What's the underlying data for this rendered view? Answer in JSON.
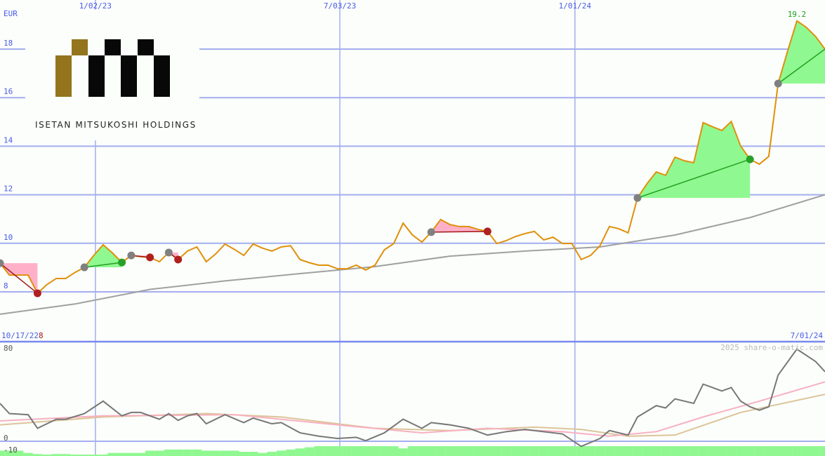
{
  "chart_data": {
    "type": "line",
    "title": "ISETAN MITSUKOSHI HOLDINGS",
    "currency": "EUR",
    "start_date": "10/17/22",
    "end_date": "7/01/24",
    "start_value_label": "8",
    "peak_label": "19.2",
    "watermark": "2025 share-o-matic.com",
    "x_ticks": [
      {
        "label": "1/02/23",
        "week": 11
      },
      {
        "label": "7/03/23",
        "week": 37
      },
      {
        "label": "1/01/24",
        "week": 62
      }
    ],
    "price_axis": {
      "ticks": [
        8,
        10,
        12,
        14,
        16,
        18
      ],
      "ylim": [
        7.6,
        20.0
      ]
    },
    "weeks": 88,
    "price": [
      9.18,
      8.69,
      8.69,
      8.69,
      7.94,
      8.3,
      8.55,
      8.55,
      8.8,
      9.01,
      9.5,
      9.94,
      9.6,
      9.21,
      9.5,
      9.45,
      9.42,
      9.24,
      9.62,
      9.33,
      9.68,
      9.85,
      9.24,
      9.56,
      9.97,
      9.75,
      9.5,
      9.97,
      9.8,
      9.68,
      9.85,
      9.9,
      9.33,
      9.2,
      9.1,
      9.1,
      8.95,
      8.95,
      9.1,
      8.9,
      9.1,
      9.73,
      9.99,
      10.83,
      10.34,
      10.05,
      10.46,
      10.98,
      10.77,
      10.69,
      10.69,
      10.57,
      10.49,
      9.99,
      10.11,
      10.28,
      10.4,
      10.49,
      10.14,
      10.25,
      9.99,
      9.99,
      9.33,
      9.5,
      9.9,
      10.69,
      10.6,
      10.43,
      11.87,
      12.45,
      12.94,
      12.8,
      13.55,
      13.4,
      13.32,
      14.97,
      14.8,
      14.65,
      15.02,
      14.01,
      13.46,
      13.26,
      13.58,
      16.58,
      17.9,
      19.16,
      18.9,
      18.52,
      18.0
    ],
    "moving_average": {
      "every_weeks": 8,
      "values": [
        7.08,
        7.5,
        8.1,
        8.45,
        8.75,
        9.04,
        9.47,
        9.68,
        9.85,
        10.34,
        11.06,
        12.0
      ]
    },
    "signals": [
      {
        "start": 0,
        "end": 4,
        "dir": "down"
      },
      {
        "start": 9,
        "end": 13,
        "dir": "up"
      },
      {
        "start": 14,
        "end": 16,
        "dir": "down"
      },
      {
        "start": 18,
        "end": 19,
        "dir": "down"
      },
      {
        "start": 46,
        "end": 52,
        "dir": "down"
      },
      {
        "start": 68,
        "end": 80,
        "dir": "up"
      },
      {
        "start": 83,
        "end": 88,
        "dir": "up"
      }
    ],
    "oscillator_axis": {
      "ticks": [
        {
          "label": "80",
          "value": 80
        },
        {
          "label": "0",
          "value": 0
        },
        {
          "label": "-10",
          "value": -10
        }
      ],
      "ylim": [
        -13,
        80
      ]
    },
    "oscillator": [
      [
        0,
        31
      ],
      [
        1,
        22
      ],
      [
        3,
        21
      ],
      [
        4,
        9
      ],
      [
        6,
        17
      ],
      [
        7,
        17
      ],
      [
        9,
        22
      ],
      [
        11,
        33
      ],
      [
        13,
        20
      ],
      [
        14,
        23
      ],
      [
        15,
        23
      ],
      [
        17,
        17
      ],
      [
        18,
        22
      ],
      [
        19,
        16
      ],
      [
        20,
        20
      ],
      [
        21,
        22
      ],
      [
        22,
        13
      ],
      [
        24,
        21
      ],
      [
        26,
        14
      ],
      [
        27,
        18
      ],
      [
        29,
        13
      ],
      [
        30,
        14
      ],
      [
        32,
        5
      ],
      [
        34,
        2
      ],
      [
        36,
        0
      ],
      [
        38,
        1
      ],
      [
        39,
        -2
      ],
      [
        41,
        5
      ],
      [
        43,
        17
      ],
      [
        45,
        9
      ],
      [
        46,
        14
      ],
      [
        48,
        12
      ],
      [
        50,
        9
      ],
      [
        52,
        3
      ],
      [
        54,
        6
      ],
      [
        56,
        8
      ],
      [
        58,
        6
      ],
      [
        60,
        4
      ],
      [
        62,
        -7
      ],
      [
        64,
        0
      ],
      [
        65,
        7
      ],
      [
        67,
        3
      ],
      [
        68,
        19
      ],
      [
        70,
        29
      ],
      [
        71,
        27
      ],
      [
        72,
        35
      ],
      [
        74,
        31
      ],
      [
        75,
        48
      ],
      [
        77,
        42
      ],
      [
        78,
        45
      ],
      [
        79,
        33
      ],
      [
        80,
        28
      ],
      [
        81,
        25
      ],
      [
        82,
        28
      ],
      [
        83,
        56
      ],
      [
        85,
        79
      ],
      [
        87,
        68
      ],
      [
        88,
        59
      ]
    ],
    "signal_line_pink": [
      [
        0,
        15.5
      ],
      [
        11,
        20
      ],
      [
        25,
        21
      ],
      [
        36,
        12
      ],
      [
        45,
        5
      ],
      [
        52,
        9
      ],
      [
        60,
        6
      ],
      [
        65,
        2
      ],
      [
        70,
        6
      ],
      [
        75,
        19
      ],
      [
        81,
        33
      ],
      [
        88,
        50
      ]
    ],
    "signal_line_tan": [
      [
        0,
        12
      ],
      [
        11,
        19
      ],
      [
        22,
        22
      ],
      [
        30,
        19
      ],
      [
        40,
        9
      ],
      [
        48,
        7
      ],
      [
        57,
        10
      ],
      [
        62,
        8
      ],
      [
        67,
        2
      ],
      [
        72,
        3
      ],
      [
        79,
        23
      ],
      [
        88,
        39
      ]
    ],
    "histogram": [
      -8,
      -8,
      -8,
      -6,
      -5,
      -4,
      -5,
      -5,
      -3,
      -3,
      -3,
      -3,
      -6,
      -6,
      -6,
      -6,
      -8,
      -8,
      -9,
      -9,
      -9,
      -9,
      -8,
      -8,
      -8,
      -8,
      -7,
      -7,
      -6,
      -7,
      -8,
      -9,
      -10,
      -11,
      -12,
      -12,
      -12,
      -12,
      -12,
      -12,
      -12,
      -12,
      -12,
      -10,
      -12,
      -12,
      -12,
      -12,
      -12,
      -12,
      -12,
      -12,
      -12,
      -12,
      -12,
      -12,
      -12,
      -12,
      -12,
      -12,
      -12,
      -12,
      -12,
      -12,
      -12,
      -12,
      -12,
      -12,
      -12,
      -12,
      -12,
      -12,
      -12,
      -12,
      -12,
      -12,
      -12,
      -12,
      -12,
      -12,
      -12,
      -12,
      -12,
      -12,
      -12,
      -12,
      -12,
      -12,
      -12
    ],
    "colors": {
      "grid": "#a4aef0",
      "axis_text": "#4a5ae8",
      "price": "#e0900a",
      "ma": "#a0a0a0",
      "up": "#90f890",
      "down": "#ffb0c8",
      "up_line": "#20a020",
      "down_line": "#a01818",
      "osc": "#777777",
      "pink": "#f8b0c0",
      "tan": "#dcc498",
      "logo_gold": "#94741c"
    }
  }
}
